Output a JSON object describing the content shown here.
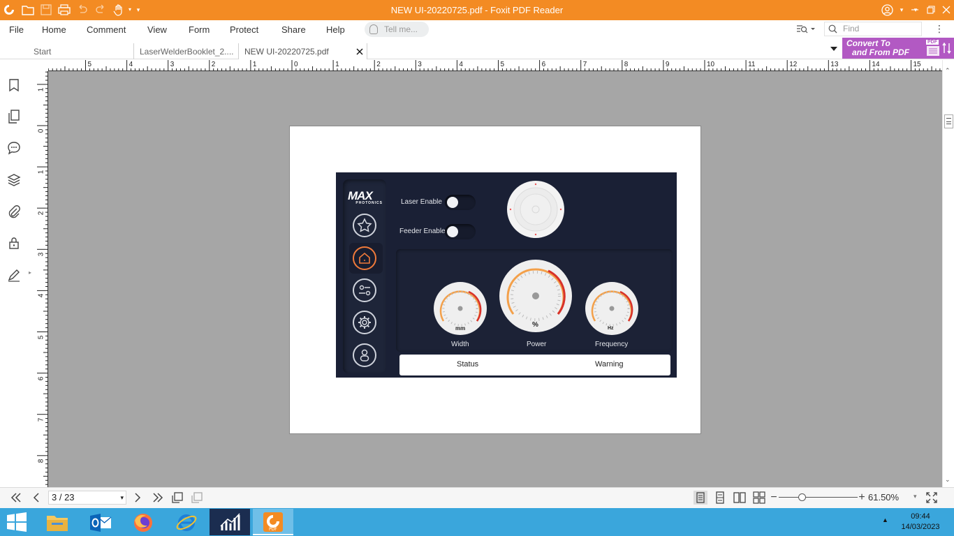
{
  "window": {
    "title": "NEW UI-20220725.pdf - Foxit PDF Reader"
  },
  "menu": {
    "items": [
      "File",
      "Home",
      "Comment",
      "View",
      "Form",
      "Protect",
      "Share",
      "Help"
    ],
    "tellme_placeholder": "Tell me...",
    "find_placeholder": "Find"
  },
  "tabs": [
    {
      "label": "Start"
    },
    {
      "label": "LaserWelderBooklet_2...."
    },
    {
      "label": "NEW UI-20220725.pdf"
    }
  ],
  "convert_banner": {
    "line1": "Convert To",
    "line2": "and From PDF",
    "badge": "PDF"
  },
  "ruler": {
    "h_labels": [
      "5",
      "4",
      "3",
      "2",
      "1",
      "0",
      "1",
      "2",
      "3",
      "4",
      "5",
      "6",
      "7",
      "8",
      "9",
      "10",
      "11",
      "12",
      "13",
      "14",
      "15"
    ],
    "v_labels": [
      "1",
      "0",
      "1",
      "2",
      "3",
      "4",
      "5",
      "6",
      "7",
      "8"
    ]
  },
  "hmi": {
    "logo_main": "MAX",
    "logo_sub": "PHOTONICS",
    "laser_enable_label": "Laser Enable",
    "feeder_enable_label": "Feeder Enable",
    "gauges": [
      {
        "label": "Width",
        "unit": "mm"
      },
      {
        "label": "Power",
        "unit": "%"
      },
      {
        "label": "Frequency",
        "unit": "Hz"
      }
    ],
    "status_label": "Status",
    "warning_label": "Warning"
  },
  "nav": {
    "page_indicator": "3 / 23",
    "zoom": "61.50%"
  },
  "clock": {
    "time": "09:44",
    "date": "14/03/2023"
  },
  "colors": {
    "titlebar": "#f38b23",
    "canvas": "#a6a6a6",
    "hmi_bg": "#1a2035",
    "accent": "#f07a3a",
    "taskbar": "#3aa6dc"
  }
}
